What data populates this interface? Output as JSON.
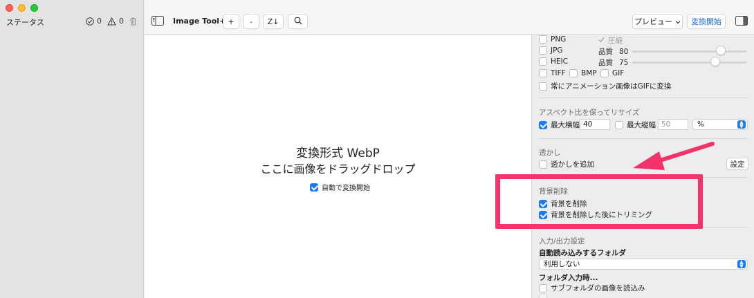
{
  "sidebar": {
    "status_label": "ステータス",
    "ok_count": "0",
    "warn_count": "0"
  },
  "toolbar": {
    "title": "Image Tool+",
    "add_label": "+",
    "remove_label": "-",
    "sort_label": "Z↓",
    "preview_label": "プレビュー",
    "convert_label": "変換開始"
  },
  "drop": {
    "title": "変換形式 WebP",
    "subtitle": "ここに画像をドラッグドロップ",
    "auto_convert_label": "自動で変換開始"
  },
  "panel": {
    "formats": {
      "png_label": "PNG",
      "compress_label": "圧縮",
      "jpg_label": "JPG",
      "jpg_quality_label": "品質",
      "jpg_quality_value": "80",
      "heic_label": "HEIC",
      "heic_quality_label": "品質",
      "heic_quality_value": "75",
      "tiff_label": "TIFF",
      "bmp_label": "BMP",
      "gif_label": "GIF",
      "anim_gif_label": "常にアニメーション画像はGIFに変換",
      "jpg_quality_fraction": 0.8,
      "heic_quality_fraction": 0.75
    },
    "resize": {
      "section_title": "アスペクト比を保ってリサイズ",
      "max_width_label": "最大横幅",
      "max_width_value": "40",
      "max_height_label": "最大縦幅",
      "max_height_value": "50",
      "unit_value": "%"
    },
    "watermark": {
      "section_title": "透かし",
      "add_label": "透かしを追加",
      "settings_label": "設定"
    },
    "background": {
      "section_title": "背景削除",
      "remove_label": "背景を削除",
      "trim_label": "背景を削除した後にトリミング"
    },
    "io": {
      "section_title": "入力/出力設定",
      "auto_folder_title": "自動読み込みするフォルダ",
      "auto_folder_value": "利用しない",
      "folder_input_title": "フォルダ入力時...",
      "subfolder_label": "サブフォルダの画像を読込み"
    }
  },
  "colors": {
    "accent": "#1a7cf5",
    "annotation": "#f5336b"
  }
}
